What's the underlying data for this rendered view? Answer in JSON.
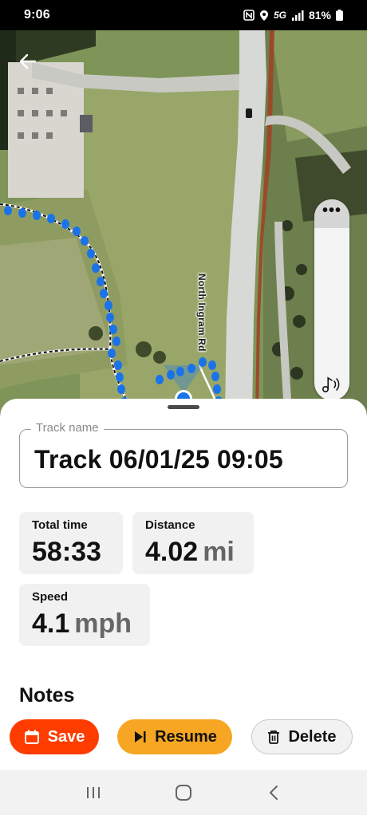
{
  "status_bar": {
    "time": "9:06",
    "network": "5G",
    "battery": "81%",
    "icons": [
      "nfc-icon",
      "location-icon",
      "signal-icon",
      "battery-icon"
    ]
  },
  "map": {
    "road_label": "North Ingram Rd",
    "more_label": "•••",
    "icons": [
      "back-arrow-icon",
      "music-note-icon",
      "gps-location-icon"
    ]
  },
  "track": {
    "field_label": "Track name",
    "name": "Track 06/01/25 09:05"
  },
  "stats": {
    "total_time": {
      "label": "Total time",
      "value": "58:33"
    },
    "distance": {
      "label": "Distance",
      "value": "4.02",
      "unit": "mi"
    },
    "speed": {
      "label": "Speed",
      "value": "4.1",
      "unit": "mph"
    }
  },
  "notes": {
    "title": "Notes"
  },
  "actions": {
    "save": "Save",
    "resume": "Resume",
    "delete": "Delete"
  },
  "colors": {
    "save": "#ff3c00",
    "resume": "#f6a623",
    "track_dots": "#1a73e8"
  }
}
